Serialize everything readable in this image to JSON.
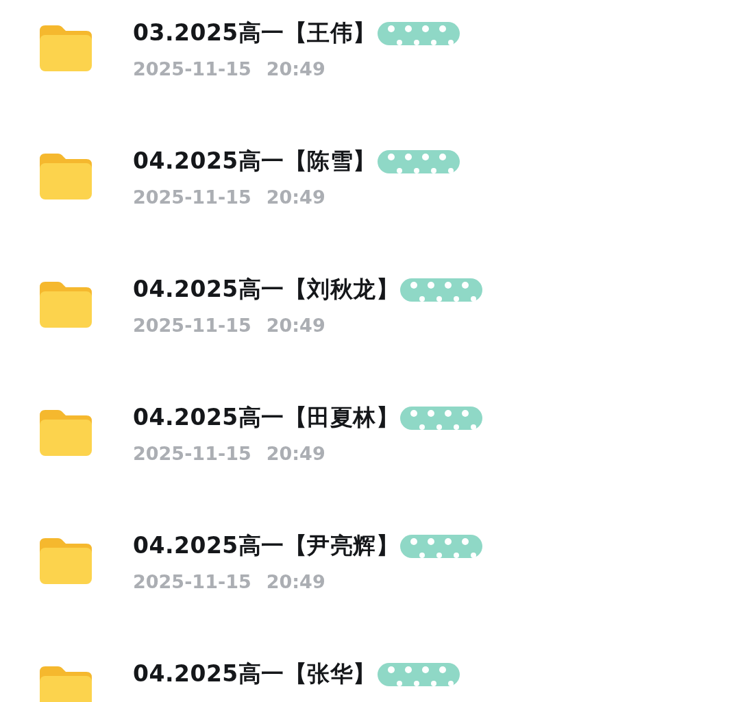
{
  "files": [
    {
      "name": "03.2025高一【王伟】",
      "date": "2025-11-15",
      "time": "20:49",
      "redacted": true
    },
    {
      "name": "04.2025高一【陈雪】",
      "date": "2025-11-15",
      "time": "20:49",
      "redacted": true
    },
    {
      "name": "04.2025高一【刘秋龙】",
      "date": "2025-11-15",
      "time": "20:49",
      "redacted": true
    },
    {
      "name": "04.2025高一【田夏林】",
      "date": "2025-11-15",
      "time": "20:49",
      "redacted": true
    },
    {
      "name": "04.2025高一【尹亮辉】",
      "date": "2025-11-15",
      "time": "20:49",
      "redacted": true
    },
    {
      "name": "04.2025高一【张华】",
      "redacted": true
    }
  ]
}
